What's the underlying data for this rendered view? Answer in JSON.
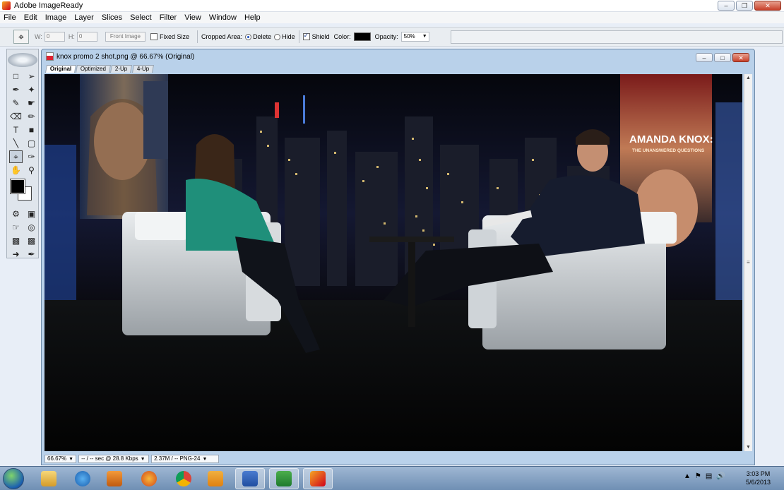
{
  "app": {
    "title": "Adobe ImageReady"
  },
  "menu": [
    "File",
    "Edit",
    "Image",
    "Layer",
    "Slices",
    "Select",
    "Filter",
    "View",
    "Window",
    "Help"
  ],
  "options_bar": {
    "w_label": "W:",
    "w_value": "0",
    "h_label": "H:",
    "h_value": "0",
    "front_image": "Front Image",
    "fixed_size": "Fixed Size",
    "cropped_area": "Cropped Area:",
    "delete_label": "Delete",
    "hide_label": "Hide",
    "shield_label": "Shield",
    "color_label": "Color:",
    "color_value": "#000000",
    "opacity_label": "Opacity:",
    "opacity_value": "50%"
  },
  "document": {
    "title": "knox promo 2 shot.png @ 66.67% (Original)",
    "tabs": [
      "Original",
      "Optimized",
      "2-Up",
      "4-Up"
    ],
    "active_tab": "Original"
  },
  "canvas_image": {
    "headline": "AMANDA KNOX:",
    "subheadline": "THE UNANSWERED QUESTIONS"
  },
  "status_bar": {
    "zoom": "66.67%",
    "download": "-- / -- sec @ 28.8 Kbps",
    "size": "2.37M / -- PNG-24"
  },
  "taskbar": {
    "apps": [
      "windows-explorer",
      "internet-explorer",
      "media-player",
      "firefox",
      "chrome",
      "outlook",
      "word",
      "excel",
      "imageready"
    ],
    "time": "3:03 PM",
    "date": "5/6/2013"
  }
}
